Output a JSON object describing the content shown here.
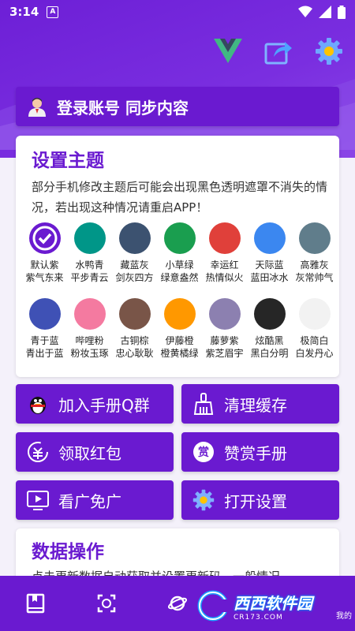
{
  "statusbar": {
    "time": "3:14",
    "badge": "A"
  },
  "login": {
    "label": "登录账号 同步内容"
  },
  "theme": {
    "title": "设置主题",
    "description": "部分手机修改主题后可能会出现黑色透明遮罩不消失的情况，若出现这种情况请重启APP！",
    "swatches": [
      {
        "line1": "默认紫",
        "line2": "紫气东来",
        "color": "#6a1ad0",
        "selected": true
      },
      {
        "line1": "水鸭青",
        "line2": "平步青云",
        "color": "#009688"
      },
      {
        "line1": "藏蓝灰",
        "line2": "剑灰四方",
        "color": "#3c5270"
      },
      {
        "line1": "小草绿",
        "line2": "绿意盎然",
        "color": "#1a9e4f"
      },
      {
        "line1": "幸运红",
        "line2": "热情似火",
        "color": "#e0403a"
      },
      {
        "line1": "天际蓝",
        "line2": "蓝田冰水",
        "color": "#3b87f0"
      },
      {
        "line1": "高雅灰",
        "line2": "灰常帅气",
        "color": "#607d8b"
      },
      {
        "line1": "青于蓝",
        "line2": "青出于蓝",
        "color": "#3f51b5"
      },
      {
        "line1": "哔哩粉",
        "line2": "粉妆玉琢",
        "color": "#f47aa0"
      },
      {
        "line1": "古铜棕",
        "line2": "忠心耿耿",
        "color": "#795548"
      },
      {
        "line1": "伊藤橙",
        "line2": "橙黄橘绿",
        "color": "#ff9800"
      },
      {
        "line1": "藤萝紫",
        "line2": "紫芝眉宇",
        "color": "#8c80b0"
      },
      {
        "line1": "炫酷黑",
        "line2": "黑白分明",
        "color": "#262626"
      },
      {
        "line1": "极简白",
        "line2": "白发丹心",
        "color": "#f2f2f2"
      }
    ]
  },
  "actions": {
    "join_group": "加入手册Q群",
    "clear_cache": "清理缓存",
    "red_packet": "领取红包",
    "reward": "赞赏手册",
    "ad_free": "看广免广",
    "settings": "打开设置",
    "reward_glyph": "赏"
  },
  "data_ops": {
    "title": "数据操作",
    "description": "点击更新数据自动获取并设置更新码，一般情况"
  },
  "watermark": {
    "brand": "西西软件园",
    "domain": "CR173.COM",
    "small": "我的"
  },
  "colors": {
    "accent": "#6a1ad0"
  }
}
